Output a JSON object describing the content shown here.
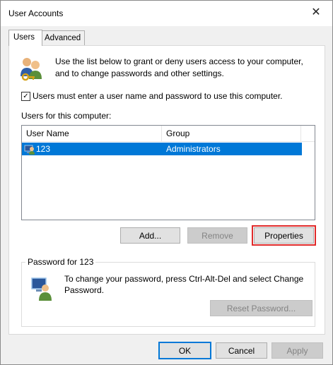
{
  "window": {
    "title": "User Accounts"
  },
  "tabs": [
    {
      "label": "Users",
      "active": true
    },
    {
      "label": "Advanced",
      "active": false
    }
  ],
  "intro": {
    "text": "Use the list below to grant or deny users access to your computer, and to change passwords and other settings."
  },
  "require_login": {
    "label": "Users must enter a user name and password to use this computer.",
    "checked": true
  },
  "users": {
    "label": "Users for this computer:",
    "columns": [
      "User Name",
      "Group"
    ],
    "rows": [
      {
        "name": "123",
        "group": "Administrators",
        "selected": true
      }
    ]
  },
  "buttons": {
    "add": "Add...",
    "remove": "Remove",
    "properties": "Properties"
  },
  "password": {
    "caption": "Password for 123",
    "text": "To change your password, press Ctrl-Alt-Del and select Change Password.",
    "reset": "Reset Password..."
  },
  "dialog_buttons": {
    "ok": "OK",
    "cancel": "Cancel",
    "apply": "Apply"
  },
  "colors": {
    "selection": "#0078d7",
    "highlight_outline": "#e02a2a"
  }
}
